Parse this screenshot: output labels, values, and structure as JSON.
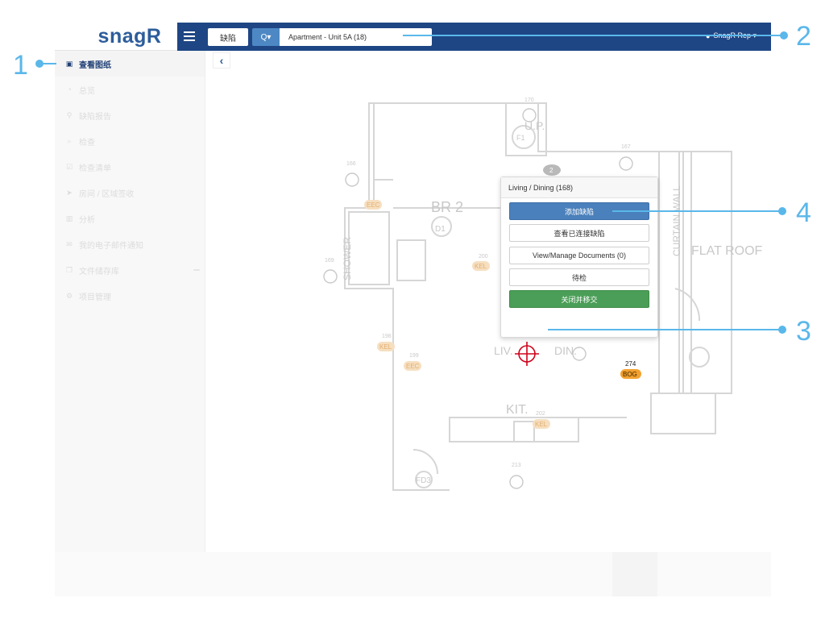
{
  "logo": "snagR",
  "sidebar": {
    "items": [
      {
        "label": "查看图纸",
        "icon": "image-icon",
        "glyph": "▣",
        "active": true
      },
      {
        "label": "总览",
        "icon": "dashboard-icon",
        "glyph": "◔"
      },
      {
        "label": "缺陷报告",
        "icon": "map-marker-icon",
        "glyph": "⚲"
      },
      {
        "label": "检查",
        "icon": "search-icon",
        "glyph": "⌕"
      },
      {
        "label": "检查清单",
        "icon": "checklist-icon",
        "glyph": "☑"
      },
      {
        "label": "房间 / 区域签收",
        "icon": "send-icon",
        "glyph": "➤"
      },
      {
        "label": "分析",
        "icon": "bar-chart-icon",
        "glyph": "▥"
      },
      {
        "label": "我的电子邮件通知",
        "icon": "envelope-icon",
        "glyph": "✉"
      },
      {
        "label": "文件储存库",
        "icon": "files-icon",
        "glyph": "❐"
      },
      {
        "label": "项目管理",
        "icon": "cogs-icon",
        "glyph": "⚙"
      }
    ]
  },
  "topbar": {
    "type_selector": "缺陷",
    "search_button": "Q▾",
    "search_value": "Apartment - Unit 5A (18)",
    "user": "SnagR Rep ▾"
  },
  "popover": {
    "title": "Living / Dining (168)",
    "buttons": [
      "添加缺陷",
      "查看已连接缺陷",
      "View/Manage Documents (0)",
      "待检",
      "关闭并移交"
    ]
  },
  "plan": {
    "rooms": [
      "BR 2",
      "U.P.",
      "FLAT ROOF",
      "CURTAIN WALL",
      "SHOWER",
      "LIV.",
      "DIN.",
      "KIT.",
      "D1",
      "FD3",
      "F1"
    ],
    "points": [
      "170",
      "167",
      "166",
      "169",
      "168",
      "200",
      "198",
      "199",
      "202",
      "213",
      "274"
    ],
    "tags": [
      "EEC",
      "KEL",
      "KEL",
      "EEC",
      "KEL",
      "BOG"
    ],
    "pin_count": "2"
  },
  "callouts": [
    "1",
    "2",
    "3",
    "4"
  ],
  "colors": {
    "navy": "#1f4684",
    "accent": "#5ab7ea",
    "blue_btn": "#4a80bb",
    "green_btn": "#4b9e57",
    "target": "#d0021b"
  }
}
